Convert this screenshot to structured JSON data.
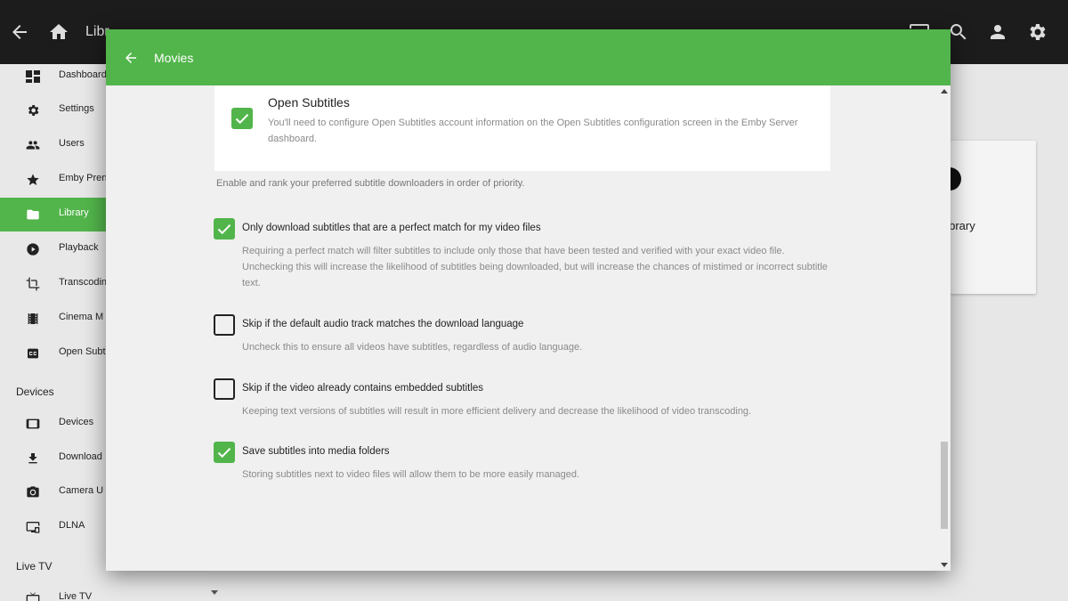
{
  "app": {
    "top_title": "Libr",
    "topbar_icons": [
      "back-arrow-icon",
      "home-icon",
      "cast-icon",
      "search-icon",
      "user-icon",
      "gear-icon"
    ]
  },
  "sidebar": {
    "items": [
      {
        "label": "Dashboard",
        "icon": "dashboard-icon"
      },
      {
        "label": "Settings",
        "icon": "gear-icon"
      },
      {
        "label": "Users",
        "icon": "users-icon"
      },
      {
        "label": "Emby Pren",
        "icon": "star-icon"
      },
      {
        "label": "Library",
        "icon": "folder-icon"
      },
      {
        "label": "Playback",
        "icon": "play-circle-icon"
      },
      {
        "label": "Transcodin",
        "icon": "crop-icon"
      },
      {
        "label": "Cinema M",
        "icon": "film-icon"
      },
      {
        "label": "Open Subt",
        "icon": "subtitles-icon"
      }
    ],
    "devices_heading": "Devices",
    "devices_items": [
      {
        "label": "Devices",
        "icon": "tablet-icon"
      },
      {
        "label": "Download",
        "icon": "download-icon"
      },
      {
        "label": "Camera U",
        "icon": "camera-icon"
      },
      {
        "label": "DLNA",
        "icon": "dlna-icon"
      }
    ],
    "livetv_heading": "Live TV",
    "livetv_items": [
      {
        "label": "Live TV",
        "icon": "tv-icon"
      }
    ]
  },
  "background_card": {
    "label": "Library"
  },
  "dialog": {
    "title": "Movies",
    "provider": {
      "name": "Open Subtitles",
      "description": "You'll need to configure Open Subtitles account information on the Open Subtitles configuration screen in the Emby Server dashboard.",
      "checked": true
    },
    "hint": "Enable and rank your preferred subtitle downloaders in order of priority.",
    "options": [
      {
        "label": "Only download subtitles that are a perfect match for my video files",
        "description": "Requiring a perfect match will filter subtitles to include only those that have been tested and verified with your exact video file. Unchecking this will increase the likelihood of subtitles being downloaded, but will increase the chances of mistimed or incorrect subtitle text.",
        "checked": true
      },
      {
        "label": "Skip if the default audio track matches the download language",
        "description": "Uncheck this to ensure all videos have subtitles, regardless of audio language.",
        "checked": false
      },
      {
        "label": "Skip if the video already contains embedded subtitles",
        "description": "Keeping text versions of subtitles will result in more efficient delivery and decrease the likelihood of video transcoding.",
        "checked": false
      },
      {
        "label": "Save subtitles into media folders",
        "description": "Storing subtitles next to video files will allow them to be more easily managed.",
        "checked": true
      }
    ]
  },
  "colors": {
    "accent": "#52b54b",
    "topbar": "#1c1c1c",
    "dialog_bg": "#f0f0f0"
  }
}
